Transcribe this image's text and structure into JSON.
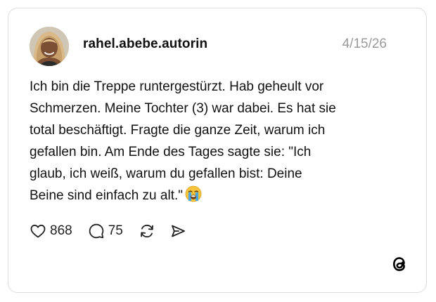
{
  "post": {
    "username": "rahel.abebe.autorin",
    "date": "4/15/26",
    "body_lines": [
      "Ich bin die Treppe runtergestürzt. Hab geheult vor",
      "Schmerzen. Meine Tochter (3) war dabei. Es hat sie",
      "total beschäftigt. Fragte die ganze Zeit, warum ich",
      "gefallen bin. Am Ende des Tages sagte sie: \"Ich",
      "glaub, ich weiß, warum du gefallen bist: Deine",
      "Beine sind einfach zu alt.\""
    ],
    "trailing_emoji": "loudly-crying-face-emoji"
  },
  "actions": {
    "likes": "868",
    "replies": "75",
    "like_icon": "heart-icon",
    "reply_icon": "comment-icon",
    "repost_icon": "repost-icon",
    "share_icon": "send-icon"
  },
  "branding": {
    "logo": "threads-logo-icon"
  },
  "colors": {
    "text": "#111111",
    "muted": "#9a9a9a",
    "border": "#dcdcdc"
  }
}
